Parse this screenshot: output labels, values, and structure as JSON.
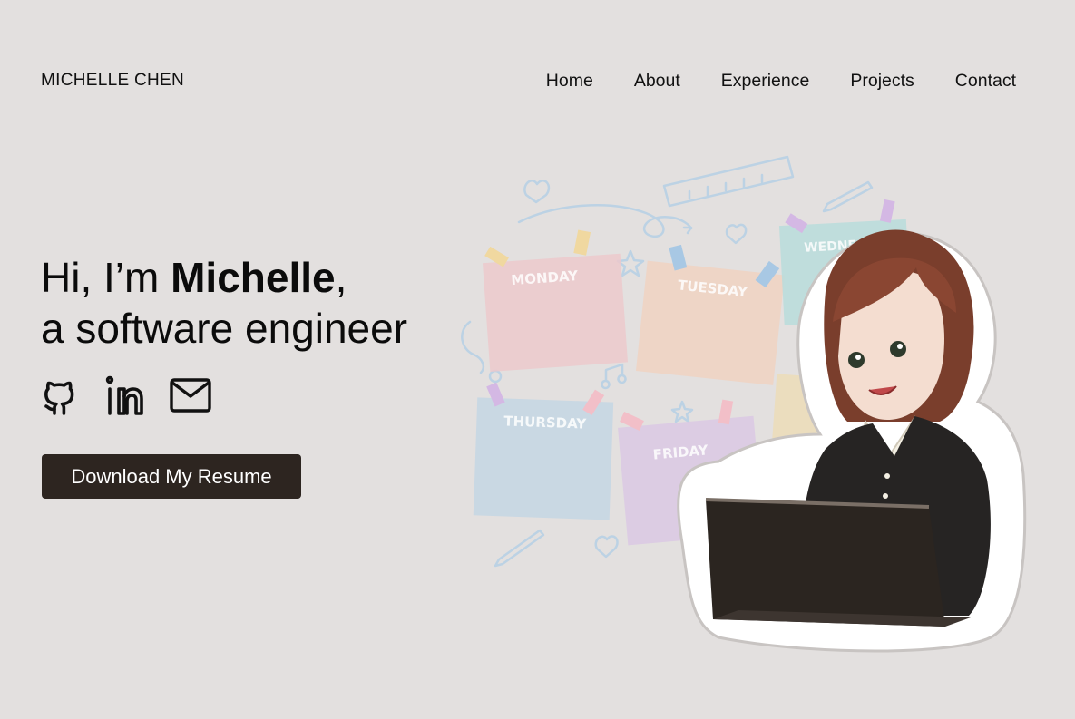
{
  "brand": {
    "name": "MICHELLE CHEN"
  },
  "nav": {
    "home": "Home",
    "about": "About",
    "experience": "Experience",
    "projects": "Projects",
    "contact": "Contact"
  },
  "hero": {
    "greeting_prefix": "Hi, I’m ",
    "name": "Michelle",
    "greeting_suffix": ",",
    "tagline": "a software engineer"
  },
  "socials": {
    "github": "github-icon",
    "linkedin": "linkedin-icon",
    "email": "mail-icon"
  },
  "cta": {
    "resume_label": "Download My Resume"
  },
  "illustration": {
    "days": [
      "MONDAY",
      "TUESDAY",
      "WEDNESDAY",
      "THURSDAY",
      "FRIDAY"
    ],
    "colors": {
      "background": "#e3e0df",
      "button": "#2d2520",
      "note_pink": "#ecc9cd",
      "note_peach": "#f0d2c2",
      "note_teal": "#b8dcdc",
      "note_blue": "#c4d6e4",
      "note_lavender": "#dac8e4",
      "note_yellow": "#ecdcb8"
    }
  }
}
